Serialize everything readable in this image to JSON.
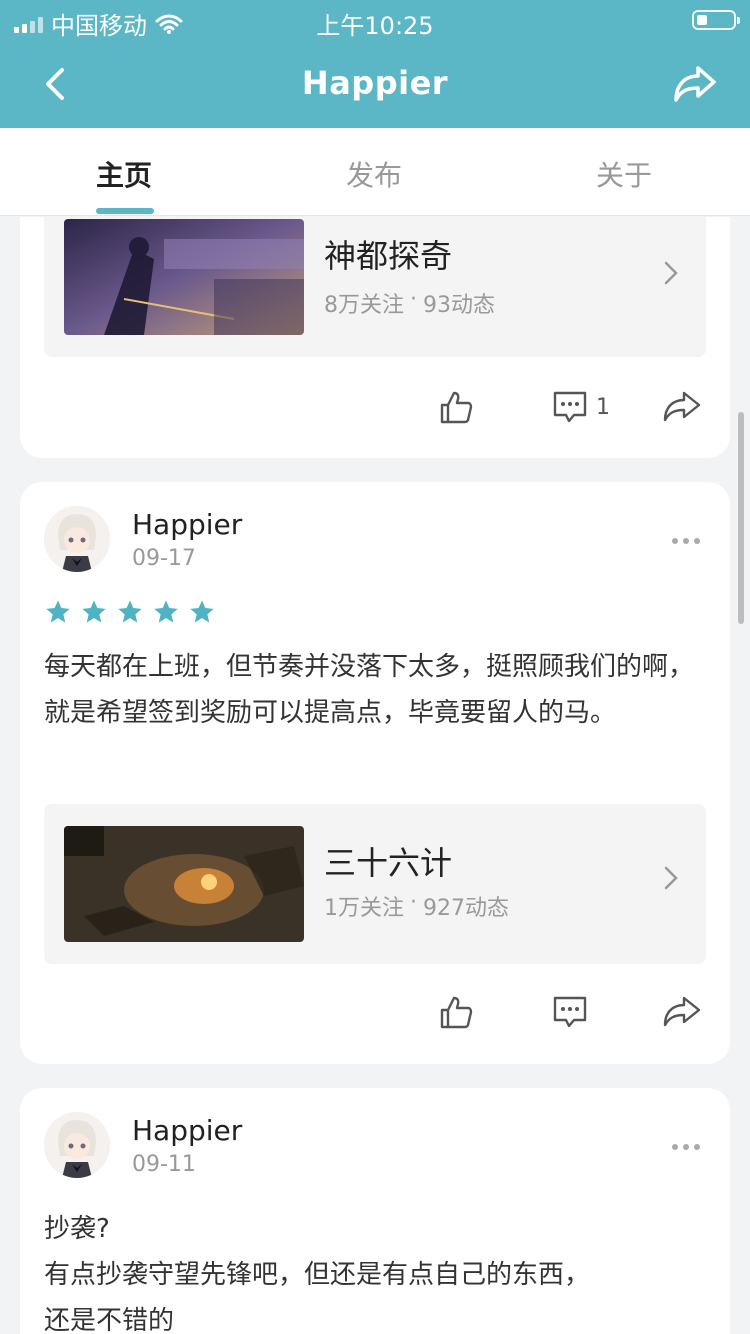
{
  "status_bar": {
    "carrier": "中国移动",
    "time": "上午10:25"
  },
  "nav": {
    "title": "Happier"
  },
  "tabs": [
    {
      "label": "主页",
      "active": true
    },
    {
      "label": "发布",
      "active": false
    },
    {
      "label": "关于",
      "active": false
    }
  ],
  "posts": [
    {
      "game": {
        "name": "神都探奇",
        "followers": "8万关注",
        "dot": "·",
        "posts": "93动态"
      },
      "actions": {
        "comment_count": "1"
      }
    },
    {
      "user": "Happier",
      "date": "09-17",
      "rating": 5,
      "text": "每天都在上班，但节奏并没落下太多，挺照顾我们的啊，就是希望签到奖励可以提高点，毕竟要留人的马。",
      "game": {
        "name": "三十六计",
        "followers": "1万关注",
        "dot": "·",
        "posts": "927动态"
      },
      "actions": {
        "comment_count": ""
      }
    },
    {
      "user": "Happier",
      "date": "09-11",
      "text_line1": "抄袭?",
      "text_line2": "有点抄袭守望先锋吧，但还是有点自己的东西，",
      "text_line3": "还是不错的"
    }
  ],
  "colors": {
    "accent": "#5bb7c6",
    "star": "#4fb3c3"
  }
}
